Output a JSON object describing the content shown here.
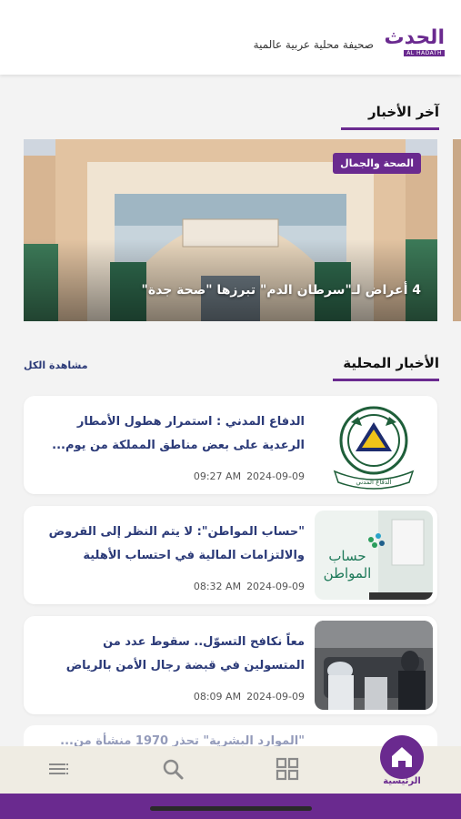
{
  "header": {
    "logo_text": "الحدث",
    "logo_sub": "AL HADATH",
    "tagline": "صحيفة محلية عربية عالمية"
  },
  "latest": {
    "title": "آخر الأخبار",
    "hero": {
      "badge": "الصحة والجمال",
      "title": "4 أعراض لـ\"سرطان الدم\" تبرزها \"صحة جدة\""
    }
  },
  "local": {
    "title": "الأخبار المحلية",
    "see_all": "مشاهدة الكل",
    "items": [
      {
        "title": "الدفاع المدني : استمرار هطول الأمطار الرعدية على بعض مناطق المملكة من يوم...",
        "date": "2024-09-09",
        "time": "09:27 AM",
        "thumb": "civil-defense-logo"
      },
      {
        "title": "\"حساب المواطن\": لا يتم النظر إلى القروض والالتزامات المالية في احتساب الأهلية",
        "date": "2024-09-09",
        "time": "08:32 AM",
        "thumb": "citizen-account-logo"
      },
      {
        "title": "معاً نكافح التسوّل.. سقوط عدد من المتسولين في قبضة رجال الأمن بالرياض",
        "date": "2024-09-09",
        "time": "08:09 AM",
        "thumb": "police-photo"
      }
    ],
    "partial_title": "\"الموارد البشرية\" تحذر 1970 منشأة من..."
  },
  "nav": {
    "home_label": "الرئيسية",
    "items": [
      "menu-icon",
      "search-icon",
      "grid-icon",
      "home-icon"
    ]
  },
  "colors": {
    "brand": "#6a2a8f",
    "headline": "#2b3a78"
  }
}
